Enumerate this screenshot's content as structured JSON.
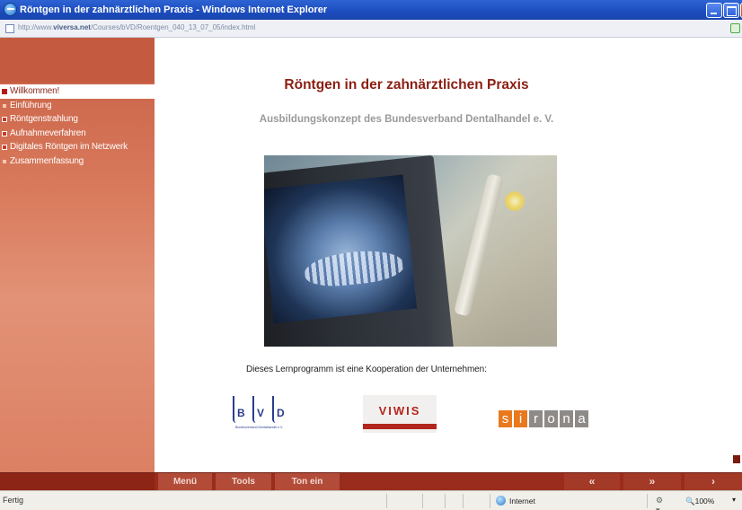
{
  "window": {
    "title": "Röntgen in der zahnärztlichen Praxis - Windows Internet Explorer",
    "icon": "ie-icon"
  },
  "address": {
    "prefix": "http://www.",
    "domain": "viversa.net",
    "path": "/Courses/bVD/Roentgen_040_13_07_05/index.html"
  },
  "sidebar": {
    "items": [
      {
        "label": "Willkommen!",
        "active": true,
        "bullet": "filled"
      },
      {
        "label": "Einführung",
        "active": false,
        "bullet": "dot"
      },
      {
        "label": "Röntgenstrahlung",
        "active": false,
        "bullet": "outline"
      },
      {
        "label": "Aufnahmeverfahren",
        "active": false,
        "bullet": "outline"
      },
      {
        "label": "Digitales Röntgen im Netzwerk",
        "active": false,
        "bullet": "outline"
      },
      {
        "label": "Zusammenfassung",
        "active": false,
        "bullet": "dot"
      }
    ]
  },
  "main": {
    "title": "Röntgen in der zahnärztlichen Praxis",
    "subtitle": "Ausbildungskonzept des Bundesverband Dentalhandel e. V.",
    "cooperation_text": "Dieses Lernprogramm ist eine Kooperation der Unternehmen:",
    "logos": {
      "bvd": {
        "letters": [
          "B",
          "V",
          "D"
        ],
        "caption": "Bundesverband Dentalhandel e.V."
      },
      "viwis": {
        "text": "VIWIS"
      },
      "sirona": {
        "letters": [
          "s",
          "i",
          "r",
          "o",
          "n",
          "a"
        ]
      }
    }
  },
  "bottom_nav": {
    "menu": "Menü",
    "tools": "Tools",
    "sound": "Ton ein",
    "prev": "«",
    "next": "»",
    "forward": "›"
  },
  "statusbar": {
    "status": "Fertig",
    "zone": "Internet",
    "zoom": "100%"
  },
  "colors": {
    "accent": "#8b1e12",
    "sidebar": "#d97a5c",
    "bottombar": "#9a2c1d",
    "sirona_orange": "#e9791d",
    "viwis_red": "#b3261e"
  }
}
